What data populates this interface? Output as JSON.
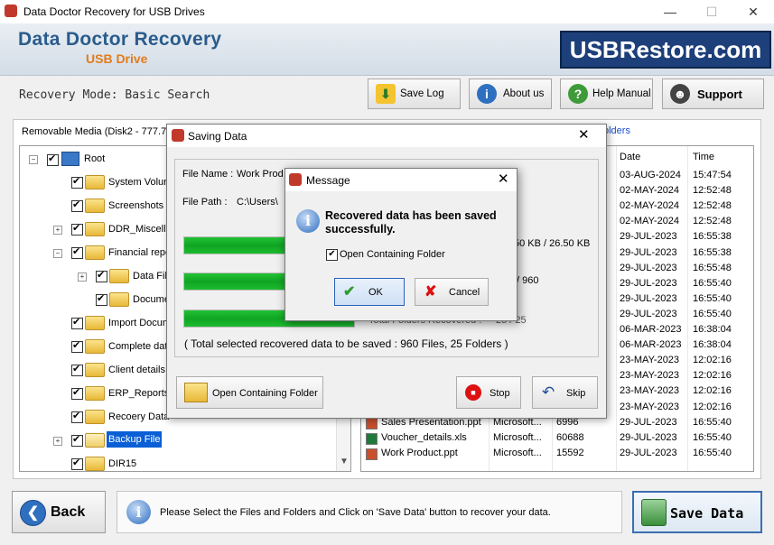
{
  "window": {
    "title": "Data Doctor Recovery for USB Drives",
    "min": "—",
    "max": "☐",
    "close": "✕"
  },
  "banner": {
    "brand_line1": "Data Doctor Recovery",
    "brand_line2": "USB Drive",
    "site": "USBRestore.com"
  },
  "mode_text": "Recovery Mode: Basic Search",
  "toolbar": {
    "save_log": "Save Log",
    "about": "About us",
    "help": "Help Manual",
    "support": "Support"
  },
  "media_label": "Removable Media (Disk2 - 777.73",
  "folders_link": "olders",
  "tree": [
    {
      "label": "Root"
    },
    {
      "label": "System Volum"
    },
    {
      "label": "Screenshots"
    },
    {
      "label": "DDR_Miscellar"
    },
    {
      "label": "Financial repo"
    },
    {
      "label": "Data File"
    },
    {
      "label": "Docume"
    },
    {
      "label": "Import Docum"
    },
    {
      "label": "Complete dat"
    },
    {
      "label": "Client details"
    },
    {
      "label": "ERP_Reports"
    },
    {
      "label": "Recoery Data"
    },
    {
      "label": "Backup File"
    },
    {
      "label": "DIR15"
    }
  ],
  "list": {
    "headers": {
      "date": "Date",
      "time": "Time"
    },
    "rows": [
      {
        "date": "03-AUG-2024",
        "time": "15:47:54"
      },
      {
        "date": "02-MAY-2024",
        "time": "12:52:48"
      },
      {
        "date": "02-MAY-2024",
        "time": "12:52:48"
      },
      {
        "date": "02-MAY-2024",
        "time": "12:52:48"
      },
      {
        "date": "29-JUL-2023",
        "time": "16:55:38"
      },
      {
        "date": "29-JUL-2023",
        "time": "16:55:38"
      },
      {
        "date": "29-JUL-2023",
        "time": "16:55:48"
      },
      {
        "date": "29-JUL-2023",
        "time": "16:55:40"
      },
      {
        "date": "29-JUL-2023",
        "time": "16:55:40"
      },
      {
        "date": "29-JUL-2023",
        "time": "16:55:40"
      },
      {
        "date": "06-MAR-2023",
        "time": "16:38:04"
      },
      {
        "date": "06-MAR-2023",
        "time": "16:38:04"
      },
      {
        "date": "23-MAY-2023",
        "time": "12:02:16"
      },
      {
        "date": "23-MAY-2023",
        "time": "12:02:16"
      },
      {
        "date": "23-MAY-2023",
        "time": "12:02:16"
      },
      {
        "date": "23-MAY-2023",
        "time": "12:02:16"
      },
      {
        "name": "Sales Presentation.ppt",
        "type": "Microsoft...",
        "size": "6996",
        "date": "29-JUL-2023",
        "time": "16:55:40"
      },
      {
        "name": "Voucher_details.xls",
        "type": "Microsoft...",
        "size": "60688",
        "date": "29-JUL-2023",
        "time": "16:55:40"
      },
      {
        "name": "Work Product.ppt",
        "type": "Microsoft...",
        "size": "15592",
        "date": "29-JUL-2023",
        "time": "16:55:40"
      }
    ]
  },
  "saving": {
    "title": "Saving Data",
    "file_name_label": "File Name :",
    "file_name_value": "Work Prod",
    "file_path_label": "File Path  :",
    "file_path_value": "C:\\Users\\",
    "partial_size": "50 KB / 26.50 KB",
    "partial_count": "/ 960",
    "folders_line": "Total Folders Recovered :",
    "folders_value": "25 / 25",
    "summary": "( Total selected recovered data to be saved : 960 Files, 25 Folders )",
    "open_folder": "Open Containing Folder",
    "stop": "Stop",
    "skip": "Skip",
    "progress": [
      1.0,
      1.0,
      1.0
    ]
  },
  "message": {
    "title": "Message",
    "text": "Recovered data has been saved successfully.",
    "checkbox": "Open Containing Folder",
    "ok": "OK",
    "cancel": "Cancel"
  },
  "bottom": {
    "back": "Back",
    "status": "Please Select the Files and Folders and Click on 'Save Data' button to recover your data.",
    "save": "Save Data"
  },
  "colors": {
    "brand_blue": "#2a5c8c",
    "brand_orange": "#e37b1b",
    "progress_green": "#1dbb2f"
  }
}
